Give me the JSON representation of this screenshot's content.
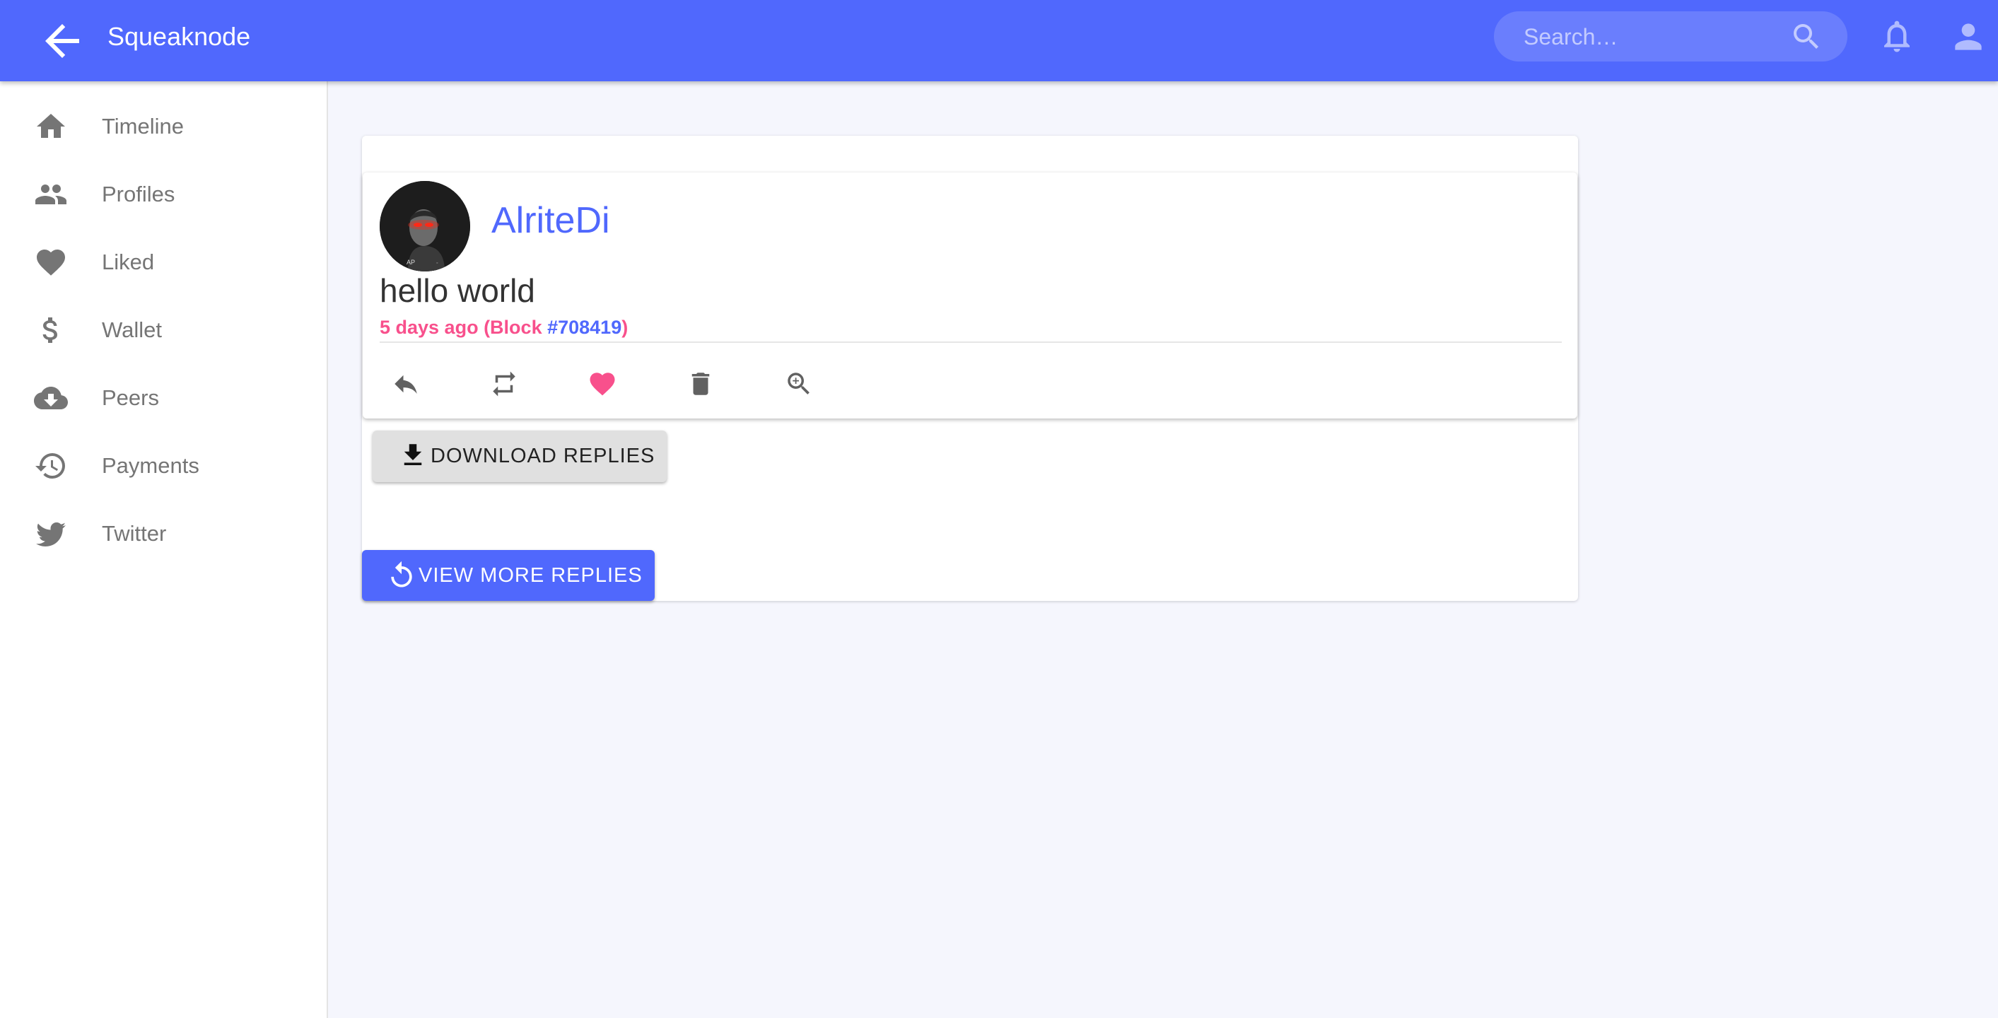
{
  "appbar": {
    "title": "Squeaknode",
    "back_icon": "arrow-back-icon",
    "search_placeholder": "Search…",
    "search_icon": "search-icon",
    "notifications_icon": "bell-icon",
    "account_icon": "account-icon"
  },
  "colors": {
    "primary": "#5068fd",
    "accent": "#f8508c",
    "background": "#f5f6fd",
    "sidebar_text": "#757575"
  },
  "sidebar": {
    "items": [
      {
        "label": "Timeline",
        "icon": "home-icon"
      },
      {
        "label": "Profiles",
        "icon": "people-icon"
      },
      {
        "label": "Liked",
        "icon": "heart-icon"
      },
      {
        "label": "Wallet",
        "icon": "dollar-icon"
      },
      {
        "label": "Peers",
        "icon": "cloud-download-icon"
      },
      {
        "label": "Payments",
        "icon": "history-icon"
      },
      {
        "label": "Twitter",
        "icon": "twitter-icon"
      }
    ]
  },
  "squeak": {
    "author": "AlriteDi",
    "avatar_icon": "avatar-image",
    "content": "hello world",
    "time_prefix": "5 days ago (Block ",
    "block": "#708419",
    "time_suffix": ")",
    "liked": true,
    "actions": [
      {
        "name": "reply",
        "icon": "reply-icon"
      },
      {
        "name": "resqueak",
        "icon": "repeat-icon"
      },
      {
        "name": "like",
        "icon": "heart-icon"
      },
      {
        "name": "delete",
        "icon": "trash-icon"
      },
      {
        "name": "view-details",
        "icon": "zoom-in-icon"
      }
    ]
  },
  "buttons": {
    "download_replies": "DOWNLOAD REPLIES",
    "view_more_replies": "VIEW MORE REPLIES"
  }
}
